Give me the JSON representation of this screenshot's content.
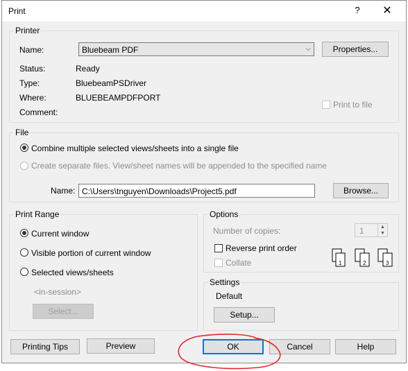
{
  "window": {
    "title": "Print",
    "help_glyph": "?",
    "close_glyph": "✕"
  },
  "printer": {
    "legend": "Printer",
    "name_label": "Name:",
    "name_value": "Bluebeam PDF",
    "properties_button": "Properties...",
    "status_label": "Status:",
    "status_value": "Ready",
    "type_label": "Type:",
    "type_value": "BluebeamPSDriver",
    "where_label": "Where:",
    "where_value": "BLUEBEAMPDFPORT",
    "comment_label": "Comment:",
    "print_to_file_label": "Print to file"
  },
  "file": {
    "legend": "File",
    "combine_label": "Combine multiple selected views/sheets into a single file",
    "separate_label": "Create separate files. View/sheet names will be appended to the specified name",
    "name_label": "Name:",
    "name_value": "C:\\Users\\tnguyen\\Downloads\\Project5.pdf",
    "browse_button": "Browse..."
  },
  "print_range": {
    "legend": "Print Range",
    "current_window_label": "Current window",
    "visible_portion_label": "Visible portion of current window",
    "selected_views_label": "Selected views/sheets",
    "in_session_label": "<in-session>",
    "select_button": "Select..."
  },
  "options": {
    "legend": "Options",
    "copies_label": "Number of copies:",
    "copies_value": "1",
    "reverse_label": "Reverse print order",
    "collate_label": "Collate",
    "icons": [
      "collate-pages-icon-1",
      "collate-pages-icon-2",
      "collate-pages-icon-3"
    ],
    "page_numbers": [
      "1",
      "2",
      "3"
    ]
  },
  "settings": {
    "legend": "Settings",
    "current_value": "Default",
    "setup_button": "Setup..."
  },
  "footer": {
    "printing_tips_button": "Printing Tips",
    "preview_button": "Preview",
    "ok_button": "OK",
    "cancel_button": "Cancel",
    "help_button": "Help"
  },
  "colors": {
    "annotation": "#e8252a",
    "default_button_border": "#0078d7",
    "dialog_background": "#f0f0f0"
  }
}
